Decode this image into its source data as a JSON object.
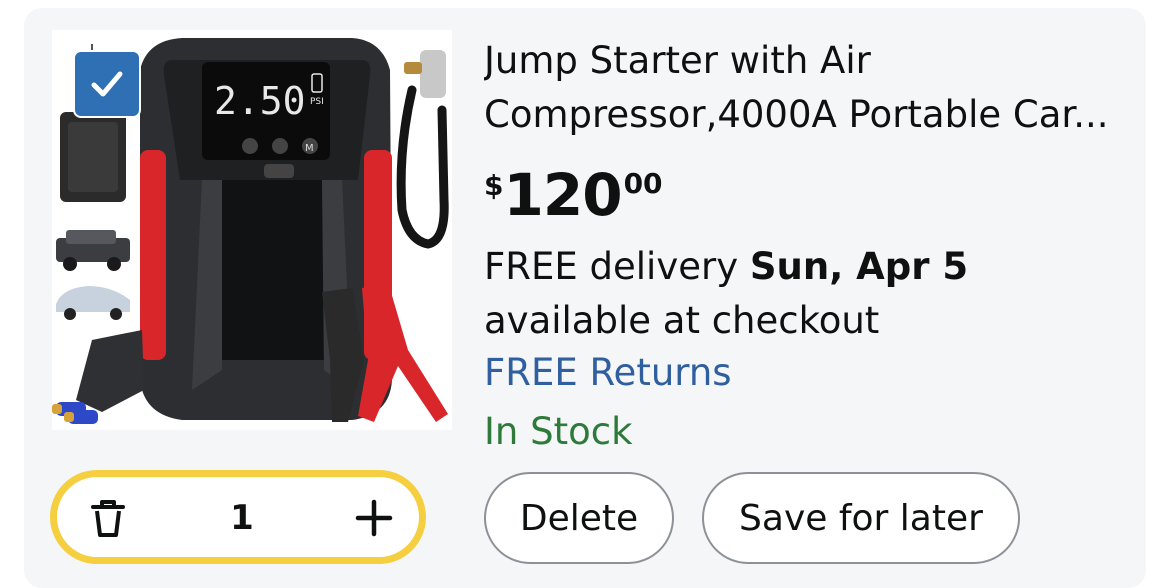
{
  "product": {
    "title": "Jump Starter with Air Compressor,4000A Portable Car...",
    "selected": true,
    "image_display": {
      "pressure_reading": "2.50",
      "pressure_unit": "PSI",
      "mode_button_label": "M"
    }
  },
  "price": {
    "symbol": "$",
    "whole": "120",
    "fraction": "00"
  },
  "delivery": {
    "prefix": "FREE delivery ",
    "date": "Sun, Apr 5",
    "suffix": " available at checkout"
  },
  "returns_label": "FREE Returns",
  "stock_status": "In Stock",
  "quantity": {
    "value": "1"
  },
  "actions": {
    "delete_label": "Delete",
    "save_for_later_label": "Save for later"
  },
  "colors": {
    "card_background": "#f5f6f8",
    "returns_link": "#2f5f9e",
    "in_stock": "#2d7a3a",
    "stepper_border": "#f5cf3f",
    "checkbox": "#2f6fb3",
    "button_border": "#8d9096"
  },
  "icons": {
    "checkbox": "checkmark-icon",
    "decrement": "trash-icon",
    "increment": "plus-icon"
  }
}
